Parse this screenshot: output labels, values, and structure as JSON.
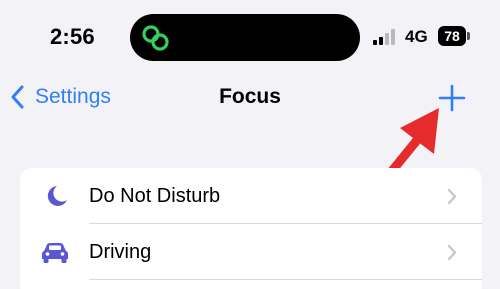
{
  "status_bar": {
    "time": "2:56",
    "network": "4G",
    "battery_level": "78",
    "island_icon": "link-icon",
    "accent_green": "#35d05d"
  },
  "nav": {
    "back_label": "Settings",
    "title": "Focus",
    "add_icon": "plus-icon",
    "tint": "#2f7ff5"
  },
  "annotation": {
    "icon": "red-arrow-icon",
    "color": "#e52b2b"
  },
  "focus_list": {
    "items": [
      {
        "label": "Do Not Disturb",
        "icon": "moon-icon",
        "icon_color": "#5b57d1"
      },
      {
        "label": "Driving",
        "icon": "car-icon",
        "icon_color": "#5b57d1"
      }
    ]
  }
}
